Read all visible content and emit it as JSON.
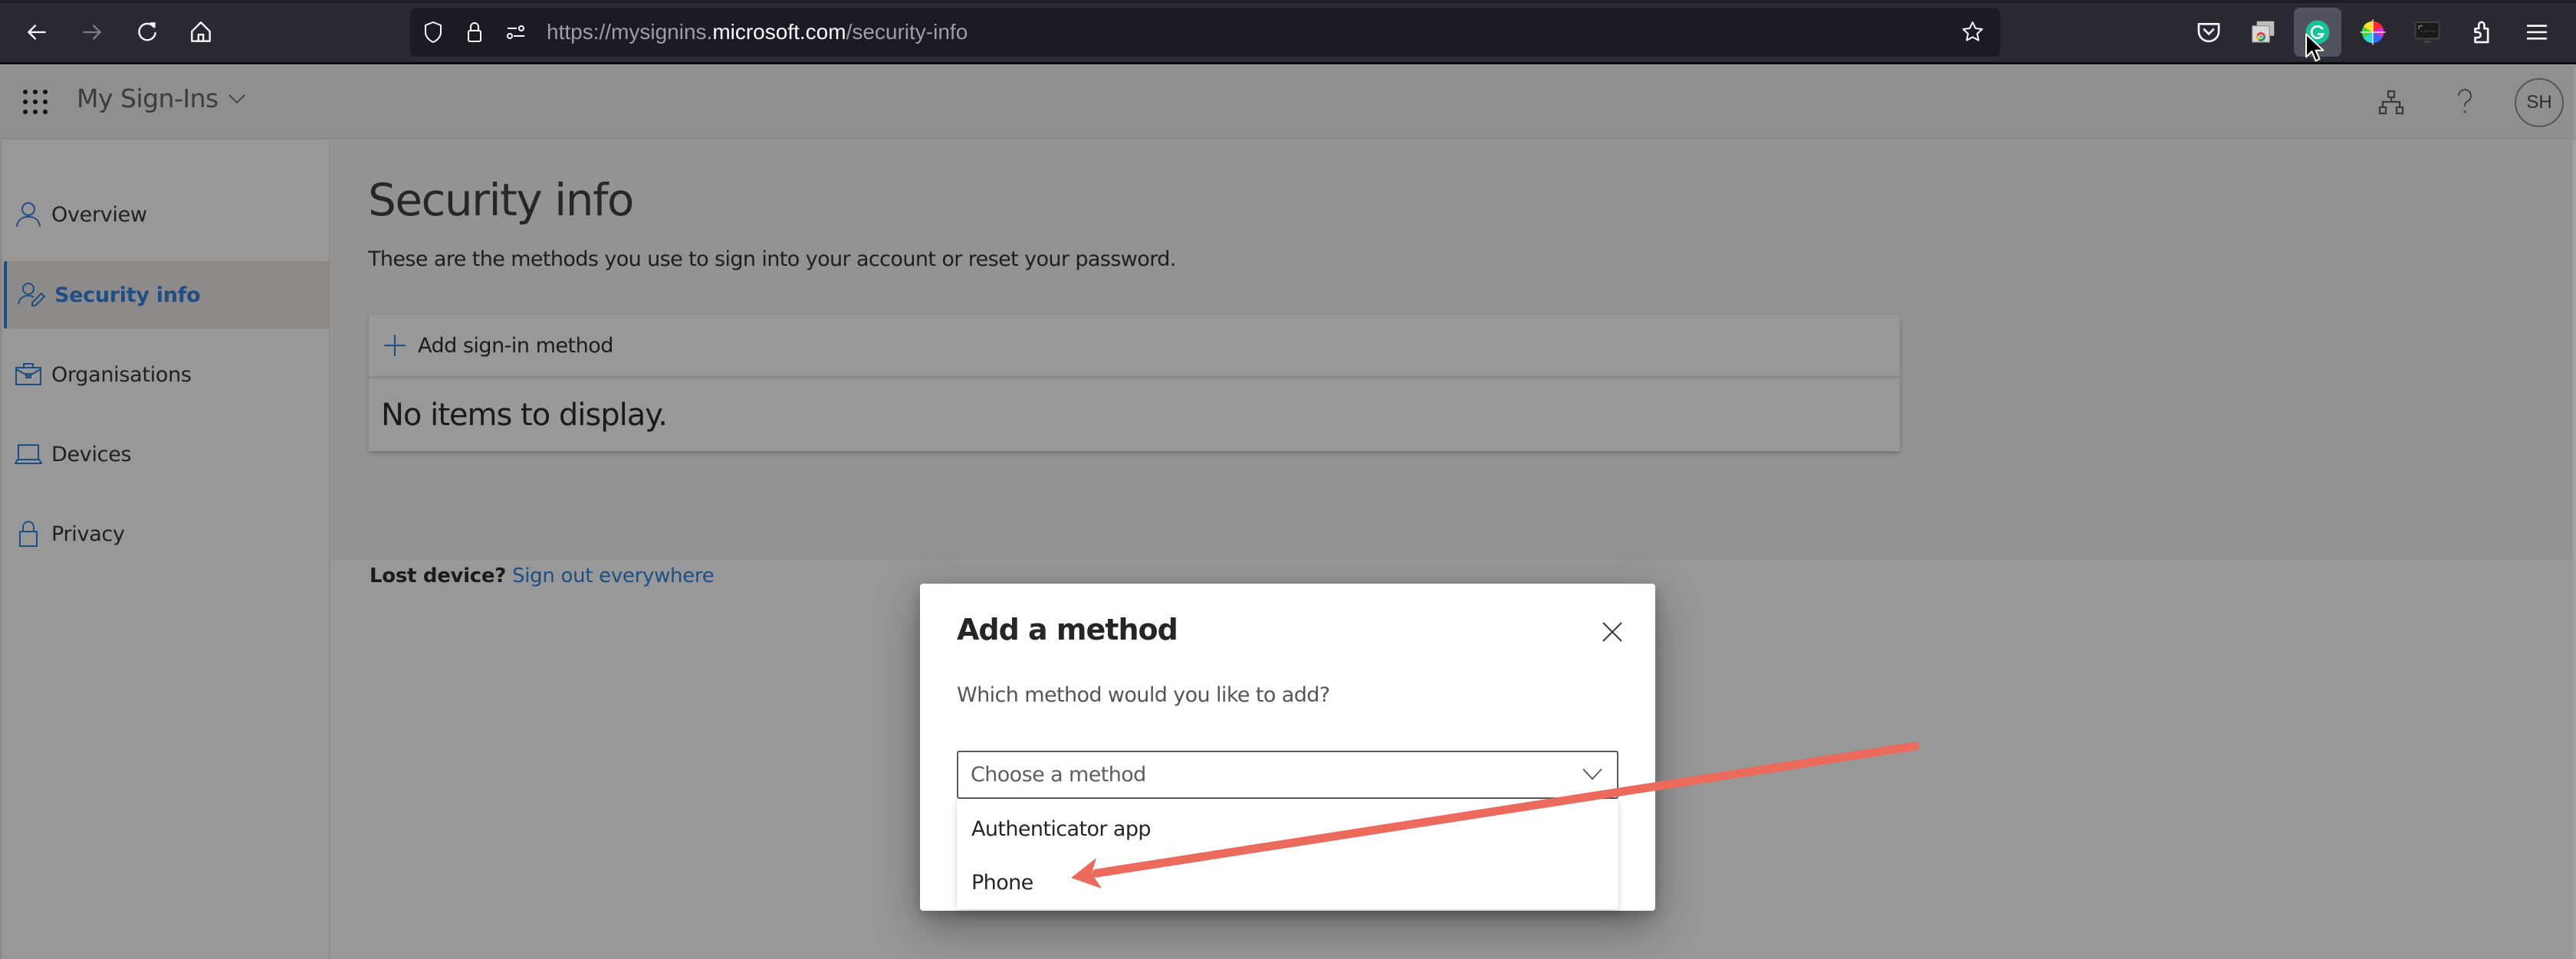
{
  "browser": {
    "url_prefix": "https://mysignins.",
    "url_host": "microsoft.com",
    "url_path": "/security-info",
    "nav": [
      "back",
      "forward",
      "reload",
      "home"
    ],
    "extensions": [
      "pocket",
      "chrome-window",
      "grammarly",
      "color-picker",
      "screen-capture",
      "extensions",
      "menu"
    ]
  },
  "app": {
    "title": "My Sign-Ins",
    "user_initials": "SH"
  },
  "sidebar": {
    "items": [
      {
        "label": "Overview",
        "icon": "person-icon",
        "selected": false
      },
      {
        "label": "Security info",
        "icon": "person-edit-icon",
        "selected": true
      },
      {
        "label": "Organisations",
        "icon": "briefcase-icon",
        "selected": false
      },
      {
        "label": "Devices",
        "icon": "laptop-icon",
        "selected": false
      },
      {
        "label": "Privacy",
        "icon": "lock-icon",
        "selected": false
      }
    ]
  },
  "main": {
    "title": "Security info",
    "subtitle": "These are the methods you use to sign into your account or reset your password.",
    "add_method_label": "Add sign-in method",
    "empty_text": "No items to display.",
    "lost_device_label": "Lost device?",
    "sign_out_link": "Sign out everywhere"
  },
  "modal": {
    "title": "Add a method",
    "question": "Which method would you like to add?",
    "select_placeholder": "Choose a method",
    "options": [
      "Authenticator app",
      "Phone"
    ]
  },
  "colors": {
    "accent": "#1f4e84",
    "annotation_arrow": "#ec6a5c",
    "grammarly": "#15c39a"
  }
}
